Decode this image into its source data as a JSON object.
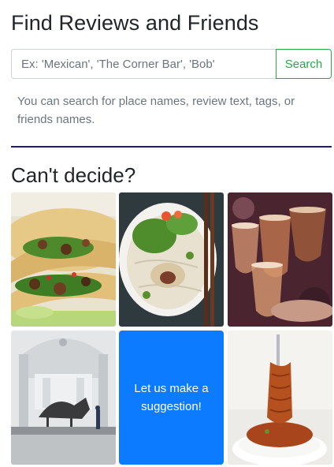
{
  "header": {
    "title": "Find Reviews and Friends"
  },
  "search": {
    "placeholder": "Ex: 'Mexican', 'The Corner Bar', 'Bob'",
    "button_label": "Search",
    "help_text": "You can search for place names, review text, tags, or friends names."
  },
  "suggestions": {
    "title": "Can't decide?",
    "tiles": [
      {
        "kind": "photo",
        "subject": "tacos-photo"
      },
      {
        "kind": "photo",
        "subject": "noodle-bowl-photo"
      },
      {
        "kind": "photo",
        "subject": "beer-glasses-photo"
      },
      {
        "kind": "photo",
        "subject": "museum-hall-photo"
      },
      {
        "kind": "action",
        "label": "Let us make a suggestion!",
        "color": "#0d7bff"
      },
      {
        "kind": "photo",
        "subject": "spaghetti-photo"
      }
    ]
  },
  "colors": {
    "accent_green": "#28a745",
    "divider": "#1f1a7a",
    "suggest_blue": "#0d7bff"
  }
}
